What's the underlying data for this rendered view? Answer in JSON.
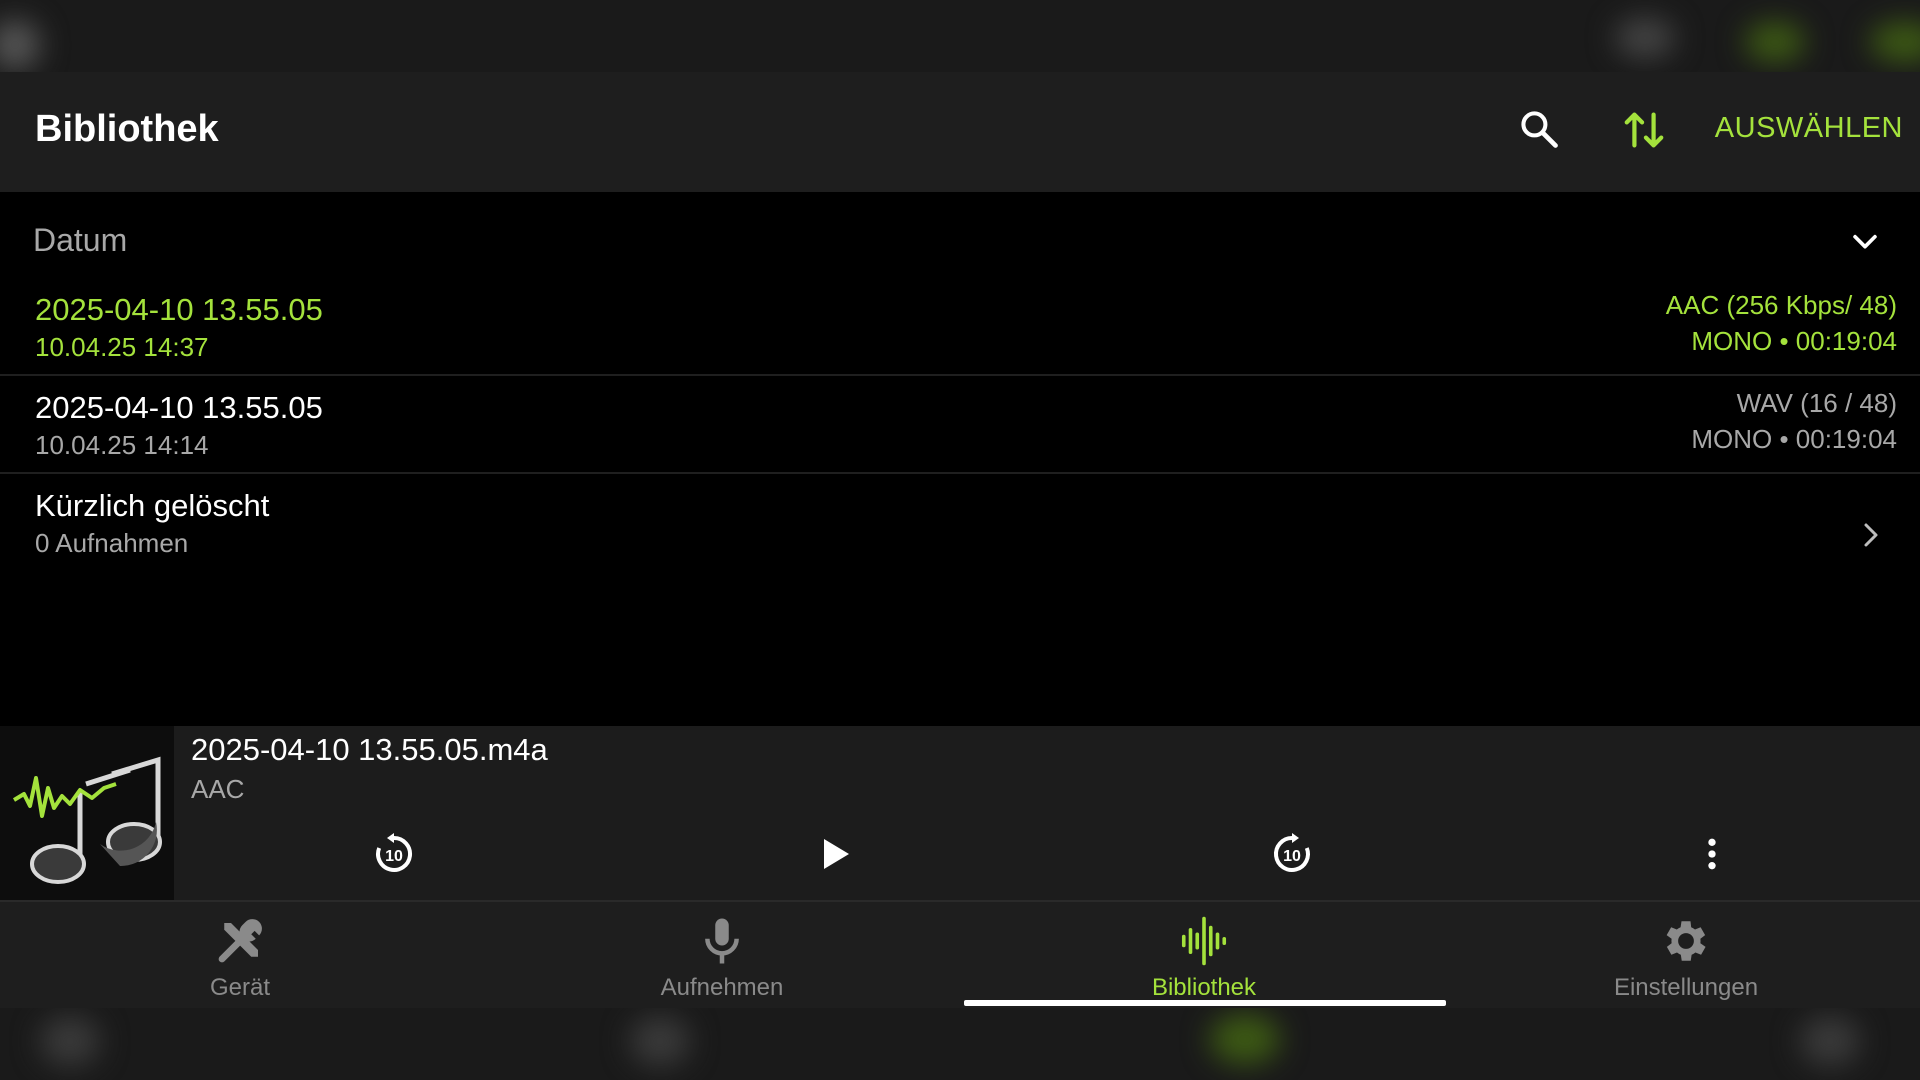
{
  "colors": {
    "accent": "#a4e23c",
    "background": "#000000",
    "bar": "#1e1e1e",
    "muted": "#a8a8a8"
  },
  "app_bar": {
    "title": "Bibliothek",
    "search_icon": "search-icon",
    "sort_icon": "sort-arrows-icon",
    "select_label": "AUSWÄHLEN"
  },
  "group": {
    "label": "Datum",
    "icon": "chevron-down-icon"
  },
  "recordings": [
    {
      "name": "2025-04-10 13.55.05",
      "date": "10.04.25 14:37",
      "format": "AAC (256 Kbps/ 48)",
      "meta": "MONO • 00:19:04",
      "active": true
    },
    {
      "name": "2025-04-10 13.55.05",
      "date": "10.04.25 14:14",
      "format": "WAV (16 / 48)",
      "meta": "MONO • 00:19:04",
      "active": false
    }
  ],
  "recently_deleted": {
    "title": "Kürzlich gelöscht",
    "count": "0 Aufnahmen",
    "icon": "chevron-right-icon"
  },
  "player": {
    "title": "2025-04-10 13.55.05.m4a",
    "codec": "AAC",
    "cover_icon": "music-note-waveform-icon",
    "rewind_label": "10",
    "forward_label": "10",
    "play_icon": "play-icon",
    "more_icon": "more-vertical-icon"
  },
  "tabs": [
    {
      "label": "Gerät",
      "icon": "tools-icon",
      "active": false
    },
    {
      "label": "Aufnehmen",
      "icon": "microphone-icon",
      "active": false
    },
    {
      "label": "Bibliothek",
      "icon": "waveform-icon",
      "active": true
    },
    {
      "label": "Einstellungen",
      "icon": "gear-icon",
      "active": false
    }
  ]
}
